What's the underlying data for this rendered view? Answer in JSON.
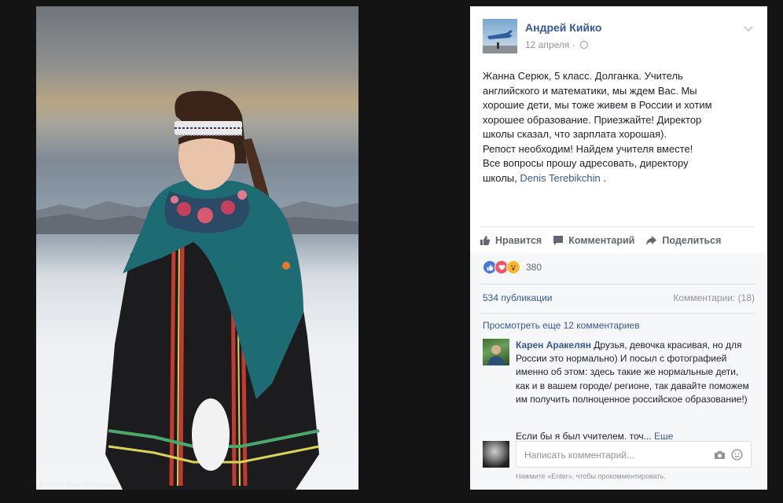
{
  "photo": {
    "watermark": "© Andrey Kiiko Photography"
  },
  "post": {
    "author": "Андрей Кийко",
    "date": "12 апреля",
    "date_separator": "·",
    "audience_icon": "globe-icon",
    "options_icon": "chevron-down-icon",
    "text_lines": [
      "Жанна Серюк, 5 класс. Долганка. Учитель",
      "английского и математики, мы ждем Вас. Мы",
      "хорошие дети, мы тоже живем в России и хотим",
      "хорошее образование. Приезжайте! Директор",
      "школы сказал, что зарплата хорошая).",
      "Репост необходим! Найдем учителя вместе!",
      "Все вопросы прошу адресовать, директору",
      "школы, "
    ],
    "mention": "Denis Terebikchin",
    "mention_suffix": " ."
  },
  "actions": {
    "like": "Нравится",
    "comment": "Комментарий",
    "share": "Поделиться"
  },
  "reactions": {
    "count": "380",
    "types": [
      "like",
      "love",
      "wow"
    ]
  },
  "stats": {
    "shares": "534 публикации",
    "comments": "Комментарии: (18)"
  },
  "comments": {
    "view_more": "Просмотреть еще 12 комментариев",
    "items": [
      {
        "author": "Карен Аракелян",
        "text": " Друзья, девочка красивая, но для России это нормально) И посыл с фотографией именно об этом: здесь такие же нормальные дети, как и в вашем городе/ регионе, так давайте поможем им получить полноценное российское образование!)",
        "truncated": "Если бы я был учителем, точ...",
        "more": "Еще"
      }
    ]
  },
  "reply": {
    "placeholder": "Написать комментарий...",
    "camera_icon": "camera-icon",
    "emoji_icon": "smiley-icon",
    "hint": "Нажмите «Enter», чтобы прокомментировать."
  },
  "colors": {
    "page_bg": "#141414",
    "card_bg": "#ffffff",
    "link": "#365899",
    "muted": "#90949c",
    "text": "#1d2129"
  }
}
